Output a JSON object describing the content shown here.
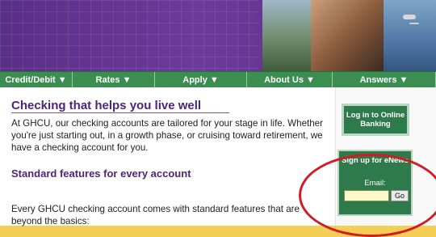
{
  "nav": {
    "items": [
      {
        "label": "Credit/Debit ▼"
      },
      {
        "label": "Rates ▼"
      },
      {
        "label": "Apply ▼"
      },
      {
        "label": "About Us ▼"
      },
      {
        "label": "Answers ▼"
      }
    ]
  },
  "main": {
    "heading": "Checking that helps you live well",
    "intro": "At GHCU, our checking accounts are tailored for your stage in life. Whether you're just starting out, in a growth phase, or cruising toward retirement, we have a checking account for you.",
    "subheading": "Standard features for every account",
    "features_text": "Every GHCU checking account comes with standard features that are beyond the basics:"
  },
  "sidebar": {
    "login_label": "Log in to Online Banking",
    "enews_title": "Sign up for eNews",
    "email_label": "Email:",
    "email_value": "",
    "go_label": "Go"
  },
  "colors": {
    "brand_purple": "#4f237d",
    "nav_green": "#3b8d52",
    "sidebar_green": "#2f7a4a",
    "annotation_red": "#d11c26"
  },
  "icons": {
    "dropdown_arrow": "▼"
  }
}
